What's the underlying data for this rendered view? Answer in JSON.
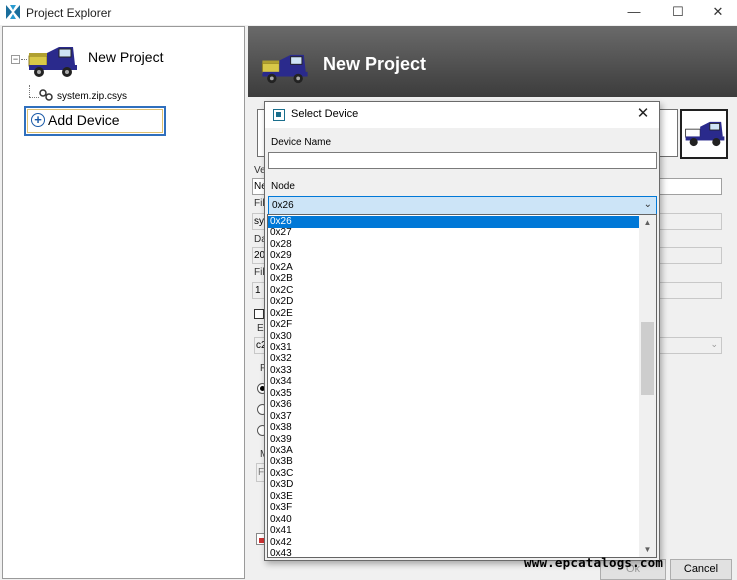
{
  "window": {
    "title": "Project Explorer",
    "minimize": "—",
    "maximize": "☐",
    "close": "✕"
  },
  "tree": {
    "project_label": "New Project",
    "expander": "−",
    "system_file": "system.zip.csys",
    "add_device_label": "Add Device"
  },
  "banner": {
    "title": "New Project"
  },
  "background_form": {
    "labels": [
      "Ve",
      "Fil",
      "Da",
      "Fil",
      "Er",
      "Pr",
      "M"
    ],
    "values": [
      "Ne",
      "sys",
      "20",
      "1",
      "c2",
      "Fi"
    ]
  },
  "dialog": {
    "title": "Select Device",
    "close": "✕",
    "device_name_label": "Device Name",
    "device_name_value": "",
    "node_label": "Node",
    "node_selected": "0x26",
    "dropdown_arrow": "⌄",
    "options": [
      "0x26",
      "0x27",
      "0x28",
      "0x29",
      "0x2A",
      "0x2B",
      "0x2C",
      "0x2D",
      "0x2E",
      "0x2F",
      "0x30",
      "0x31",
      "0x32",
      "0x33",
      "0x34",
      "0x35",
      "0x36",
      "0x37",
      "0x38",
      "0x39",
      "0x3A",
      "0x3B",
      "0x3C",
      "0x3D",
      "0x3E",
      "0x3F",
      "0x40",
      "0x41",
      "0x42",
      "0x43"
    ],
    "selected_index": 0
  },
  "buttons": {
    "ok": "Ok",
    "cancel": "Cancel"
  },
  "watermark": "www.epcatalogs.com",
  "colors": {
    "selection": "#0078d7",
    "combo_bg": "#cce4f7",
    "banner_top": "#6a6a6a",
    "cart_body": "#2a2a8c",
    "cart_cargo": "#d8c848"
  }
}
